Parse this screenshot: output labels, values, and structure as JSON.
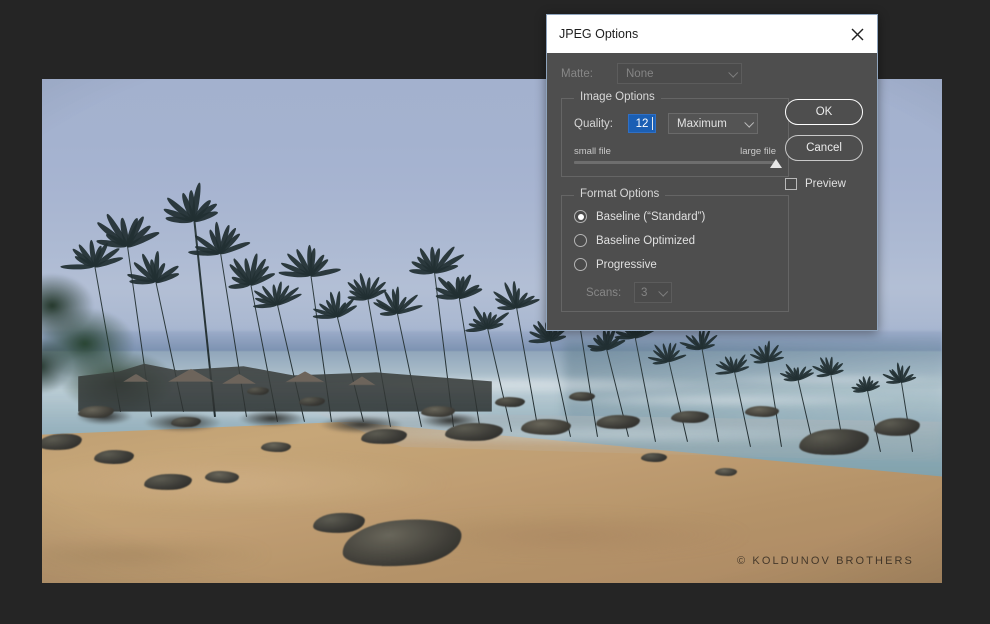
{
  "app": {
    "background_color": "#252525"
  },
  "photo": {
    "alt_description": "Tropical beach at dusk with palm trees, sand, rocks and misty long-exposure sea",
    "watermark": "© KOLDUNOV BROTHERS"
  },
  "dialog": {
    "title": "JPEG Options",
    "close_icon": "close-icon",
    "matte": {
      "label": "Matte:",
      "value": "None",
      "disabled": true
    },
    "image_options": {
      "legend": "Image Options",
      "quality_label": "Quality:",
      "quality_value": "12",
      "quality_preset": "Maximum",
      "slider_min_label": "small file",
      "slider_max_label": "large file",
      "slider_position_percent": 100
    },
    "format_options": {
      "legend": "Format Options",
      "options": [
        {
          "label": "Baseline (“Standard”)",
          "selected": true
        },
        {
          "label": "Baseline Optimized",
          "selected": false
        },
        {
          "label": "Progressive",
          "selected": false
        }
      ],
      "scans_label": "Scans:",
      "scans_value": "3",
      "scans_disabled": true
    },
    "buttons": {
      "ok": "OK",
      "cancel": "Cancel"
    },
    "preview": {
      "label": "Preview",
      "checked": false
    },
    "colors": {
      "body": "#4e4e4e",
      "titlebar": "#ffffff",
      "border": "#8fa4bd",
      "accent": "#1b5fb4"
    }
  }
}
